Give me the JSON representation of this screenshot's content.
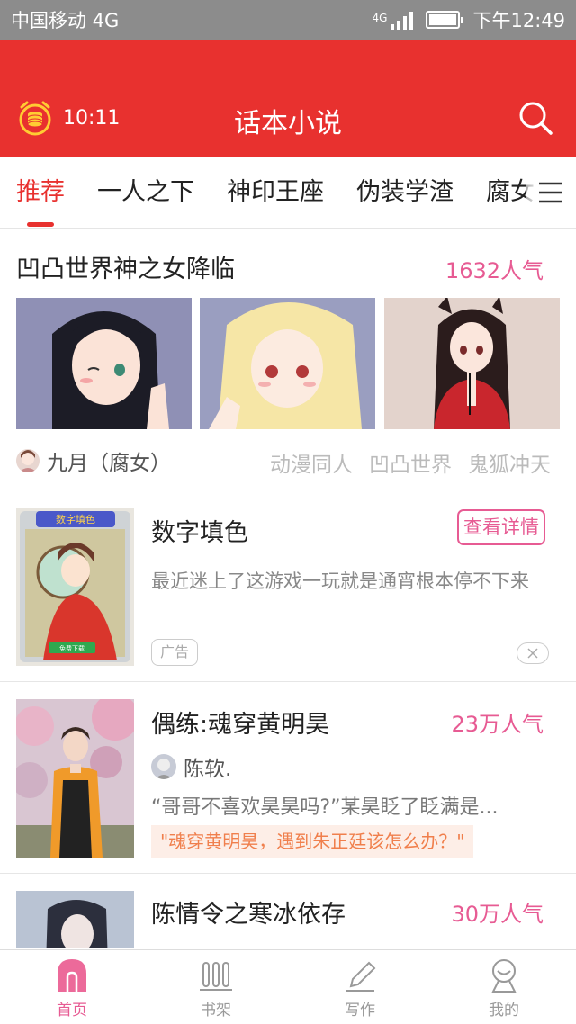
{
  "status_bar": {
    "carrier": "中国移动 4G",
    "net_label": "4G",
    "time": "下午12:49"
  },
  "app_bar": {
    "timer": "10:11",
    "title": "话本小说",
    "timer_icon": "alarm-clock-coin-icon",
    "search_icon": "search-icon"
  },
  "tabs": [
    {
      "label": "推荐",
      "active": true
    },
    {
      "label": "一人之下"
    },
    {
      "label": "神印王座"
    },
    {
      "label": "伪装学渣"
    },
    {
      "label": "腐女"
    }
  ],
  "featured": {
    "title": "凹凸世界神之女降临",
    "popularity": "1632人气",
    "author": "九月（腐女）",
    "tags": [
      "动漫同人",
      "凹凸世界",
      "鬼狐冲天"
    ]
  },
  "ad": {
    "title": "数字填色",
    "button": "查看详情",
    "description": "最近迷上了这游戏一玩就是通宵根本停不下来",
    "badge": "广告",
    "cover_text": "数字填色",
    "cover_button": "免费下载"
  },
  "story1": {
    "title": "偶练:魂穿黄明昊",
    "popularity": "23万人气",
    "author": "陈软.",
    "excerpt": "“哥哥不喜欢昊昊吗?”某昊眨了眨满是...",
    "quote": "\"魂穿黄明昊，遇到朱正廷该怎么办？\""
  },
  "story2": {
    "title": "陈情令之寒冰依存",
    "popularity": "30万人气"
  },
  "bottom_nav": [
    {
      "label": "首页",
      "icon": "home-icon",
      "active": true
    },
    {
      "label": "书架",
      "icon": "bookshelf-icon"
    },
    {
      "label": "写作",
      "icon": "pencil-icon"
    },
    {
      "label": "我的",
      "icon": "profile-icon"
    }
  ],
  "colors": {
    "brand_red": "#e8312f",
    "pink": "#e75b93",
    "quote_orange": "#f07f4c"
  }
}
